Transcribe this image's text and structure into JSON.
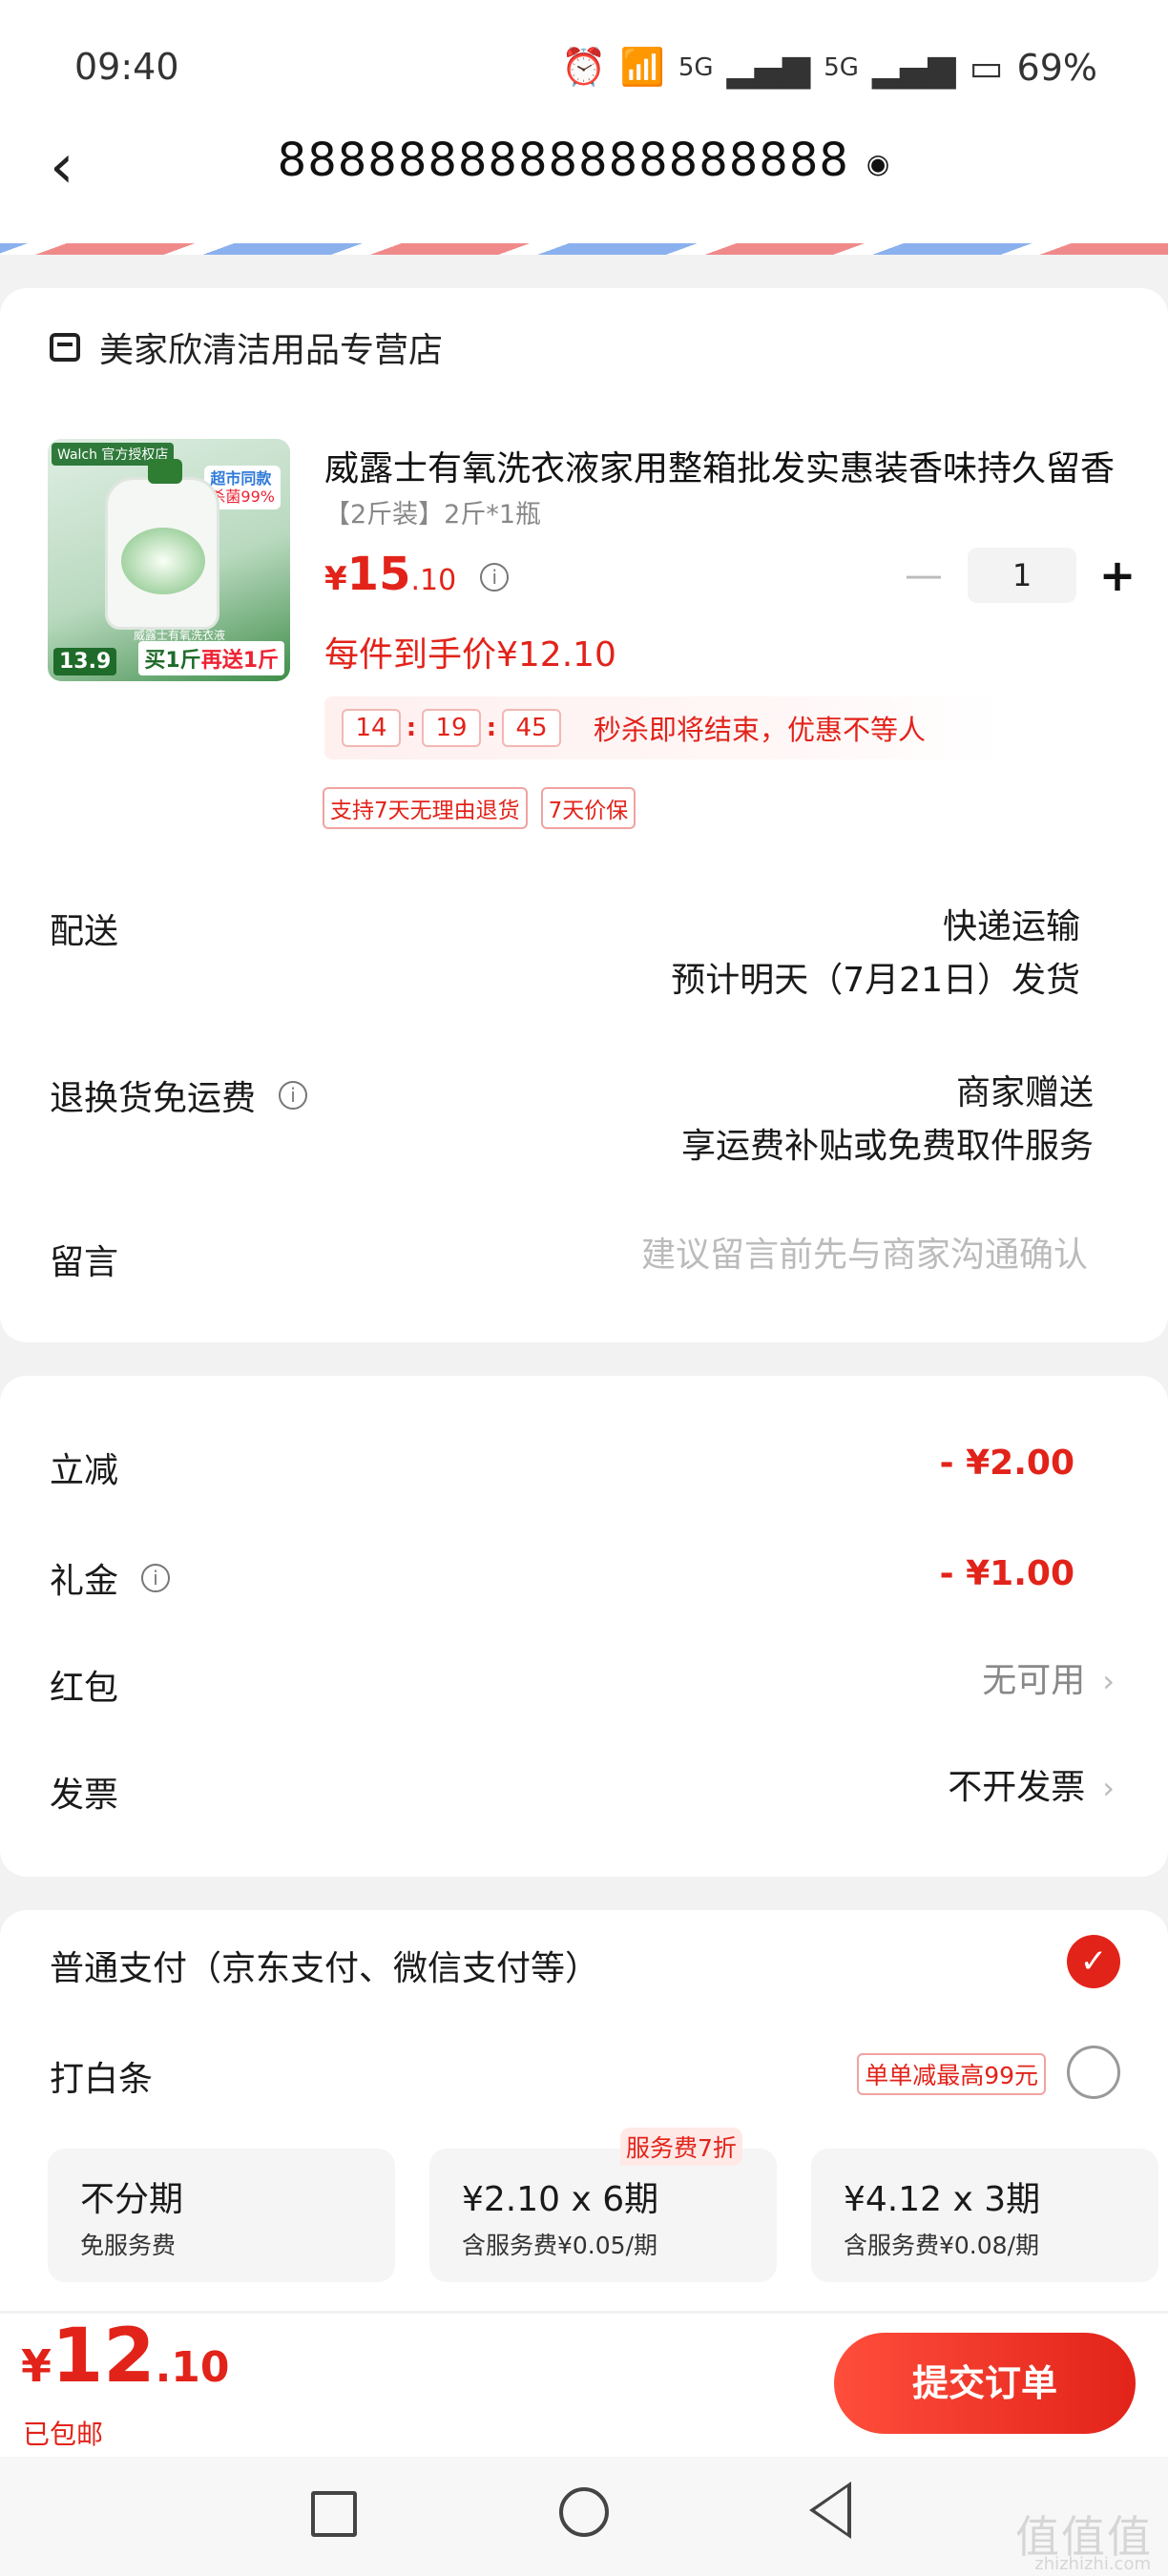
{
  "status_bar": {
    "time": "09:40",
    "battery": "69%",
    "net1": "5G",
    "net2": "5G"
  },
  "header": {
    "address": "8888888888888888888"
  },
  "store": {
    "name": "美家欣清洁用品专营店"
  },
  "product": {
    "thumb_brand": "Walch 官方授权店",
    "thumb_promo1": "超市同款",
    "thumb_promo2": "杀菌99%",
    "thumb_price": "13.9",
    "thumb_buy": "买1斤",
    "thumb_get": "再送1斤",
    "thumb_label": "威露士有氧洗衣液",
    "title": "威露士有氧洗衣液家用整箱批发实惠装香味持久留香",
    "spec": "【2斤装】2斤*1瓶",
    "price_symbol": "¥",
    "price_int": "15",
    "price_dec": ".10",
    "qty": "1",
    "final_price": "每件到手价¥12.10",
    "countdown": {
      "h": "14",
      "m": "19",
      "s": "45",
      "text": "秒杀即将结束，优惠不等人"
    },
    "tags": [
      "支持7天无理由退货",
      "7天价保"
    ]
  },
  "delivery": {
    "label": "配送",
    "method": "快递运输",
    "eta": "预计明天（7月21日）发货"
  },
  "return_shipping": {
    "label": "退换货免运费",
    "value": "商家赠送",
    "desc": "享运费补贴或免费取件服务"
  },
  "message": {
    "label": "留言",
    "placeholder": "建议留言前先与商家沟通确认"
  },
  "discounts": {
    "instant": {
      "label": "立减",
      "value": "- ¥2.00"
    },
    "gift": {
      "label": "礼金",
      "value": "- ¥1.00"
    },
    "red_packet": {
      "label": "红包",
      "value": "无可用"
    },
    "invoice": {
      "label": "发票",
      "value": "不开发票"
    }
  },
  "payment": {
    "normal": "普通支付（京东支付、微信支付等）",
    "baitiao": "打白条",
    "baitiao_promo": "单单减最高99元",
    "plans": [
      {
        "title": "不分期",
        "sub": "免服务费",
        "badge": ""
      },
      {
        "title": "¥2.10 x 6期",
        "sub": "含服务费¥0.05/期",
        "badge": "服务费7折"
      },
      {
        "title": "¥4.12 x 3期",
        "sub": "含服务费¥0.08/期",
        "badge": ""
      }
    ]
  },
  "footer": {
    "total_symbol": "¥",
    "total_int": "12",
    "total_dec": ".10",
    "shipping": "已包邮",
    "submit": "提交订单"
  },
  "watermark": {
    "main": "值值值",
    "sub": "zhizhizhi.com"
  }
}
